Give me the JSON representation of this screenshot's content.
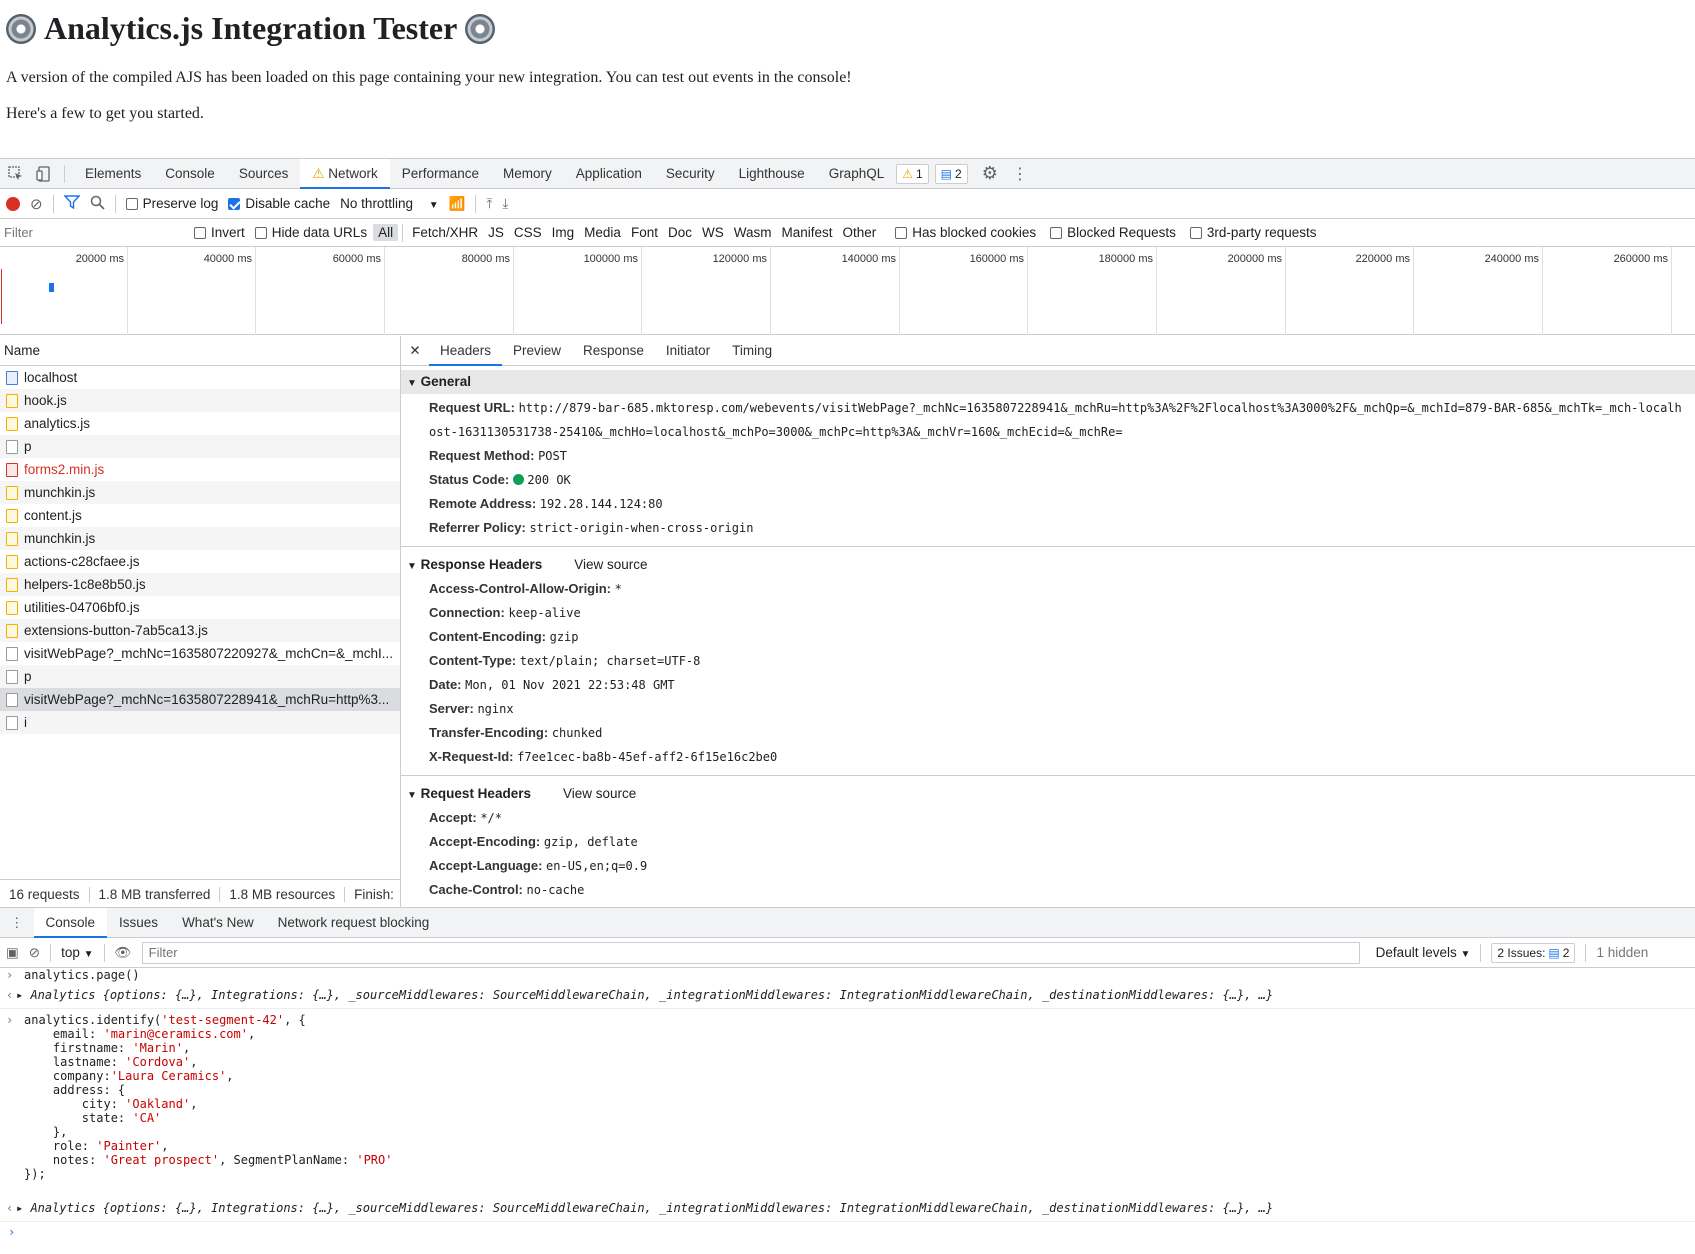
{
  "page": {
    "title": "Analytics.js Integration Tester",
    "para1": "A version of the compiled AJS has been loaded on this page containing your new integration. You can test out events in the console!",
    "para2": "Here's a few to get you started."
  },
  "devtools": {
    "tabs": [
      "Elements",
      "Console",
      "Sources",
      "Network",
      "Performance",
      "Memory",
      "Application",
      "Security",
      "Lighthouse",
      "GraphQL"
    ],
    "active_tab": "Network",
    "warn_count": "1",
    "msg_count": "2"
  },
  "network_toolbar": {
    "preserve_log": "Preserve log",
    "disable_cache": "Disable cache",
    "throttling": "No throttling"
  },
  "filterbar": {
    "placeholder": "Filter",
    "invert": "Invert",
    "hide_data_urls": "Hide data URLs",
    "types": [
      "All",
      "Fetch/XHR",
      "JS",
      "CSS",
      "Img",
      "Media",
      "Font",
      "Doc",
      "WS",
      "Wasm",
      "Manifest",
      "Other"
    ],
    "has_blocked_cookies": "Has blocked cookies",
    "blocked_requests": "Blocked Requests",
    "third_party": "3rd-party requests"
  },
  "overview": {
    "ticks": [
      "20000 ms",
      "40000 ms",
      "60000 ms",
      "80000 ms",
      "100000 ms",
      "120000 ms",
      "140000 ms",
      "160000 ms",
      "180000 ms",
      "200000 ms",
      "220000 ms",
      "240000 ms",
      "260000 ms"
    ]
  },
  "requests": {
    "header": "Name",
    "items": [
      {
        "name": "localhost",
        "kind": "doc"
      },
      {
        "name": "hook.js",
        "kind": "js"
      },
      {
        "name": "analytics.js",
        "kind": "js"
      },
      {
        "name": "p",
        "kind": "other"
      },
      {
        "name": "forms2.min.js",
        "kind": "bad"
      },
      {
        "name": "munchkin.js",
        "kind": "js"
      },
      {
        "name": "content.js",
        "kind": "js"
      },
      {
        "name": "munchkin.js",
        "kind": "js"
      },
      {
        "name": "actions-c28cfaee.js",
        "kind": "js"
      },
      {
        "name": "helpers-1c8e8b50.js",
        "kind": "js"
      },
      {
        "name": "utilities-04706bf0.js",
        "kind": "js"
      },
      {
        "name": "extensions-button-7ab5ca13.js",
        "kind": "js"
      },
      {
        "name": "visitWebPage?_mchNc=1635807220927&_mchCn=&_mchI...",
        "kind": "other"
      },
      {
        "name": "p",
        "kind": "other"
      },
      {
        "name": "visitWebPage?_mchNc=1635807228941&_mchRu=http%3...",
        "kind": "other"
      },
      {
        "name": "i",
        "kind": "other"
      }
    ],
    "footer": {
      "count": "16 requests",
      "transferred": "1.8 MB transferred",
      "resources": "1.8 MB resources",
      "finish": "Finish:"
    }
  },
  "details": {
    "tabs": [
      "Headers",
      "Preview",
      "Response",
      "Initiator",
      "Timing"
    ],
    "general_title": "General",
    "general": {
      "url_label": "Request URL:",
      "url_1": "http://879-bar-685.mktoresp.com/webevents/visitWebPage?_mchNc=1635807228941&_mchRu=http%3A%2F%2Flocalhost%3A3000%2F&_mchQp=&_mchId=879-BAR-685&_mchTk=_mch-localh",
      "url_2": "ost-1631130531738-25410&_mchHo=localhost&_mchPo=3000&_mchPc=http%3A&_mchVr=160&_mchEcid=&_mchRe=",
      "method_label": "Request Method:",
      "method": "POST",
      "status_label": "Status Code:",
      "status": "200 OK",
      "remote_label": "Remote Address:",
      "remote": "192.28.144.124:80",
      "referrer_label": "Referrer Policy:",
      "referrer": "strict-origin-when-cross-origin"
    },
    "response_title": "Response Headers",
    "view_source": "View source",
    "response": [
      {
        "k": "Access-Control-Allow-Origin:",
        "v": "*"
      },
      {
        "k": "Connection:",
        "v": "keep-alive"
      },
      {
        "k": "Content-Encoding:",
        "v": "gzip"
      },
      {
        "k": "Content-Type:",
        "v": "text/plain; charset=UTF-8"
      },
      {
        "k": "Date:",
        "v": "Mon, 01 Nov 2021 22:53:48 GMT"
      },
      {
        "k": "Server:",
        "v": "nginx"
      },
      {
        "k": "Transfer-Encoding:",
        "v": "chunked"
      },
      {
        "k": "X-Request-Id:",
        "v": "f7ee1cec-ba8b-45ef-aff2-6f15e16c2be0"
      }
    ],
    "request_title": "Request Headers",
    "request": [
      {
        "k": "Accept:",
        "v": "*/*"
      },
      {
        "k": "Accept-Encoding:",
        "v": "gzip, deflate"
      },
      {
        "k": "Accept-Language:",
        "v": "en-US,en;q=0.9"
      },
      {
        "k": "Cache-Control:",
        "v": "no-cache"
      }
    ]
  },
  "drawer": {
    "tabs": [
      "Console",
      "Issues",
      "What's New",
      "Network request blocking"
    ],
    "context": "top",
    "filter_placeholder": "Filter",
    "levels": "Default levels",
    "issues_label": "2 Issues:",
    "issues_count": "2",
    "hidden": "1 hidden"
  },
  "console": {
    "cmd1": "analytics.page()",
    "result1": "Analytics {options: {…}, Integrations: {…}, _sourceMiddlewares: SourceMiddlewareChain, _integrationMiddlewares: IntegrationMiddlewareChain, _destinationMiddlewares: {…}, …}",
    "id_call": "analytics.identify(",
    "id_arg": "'test-segment-42'",
    "id_tail": ", {",
    "email_key": "    email: ",
    "email_val": "'marin@ceramics.com'",
    "first_key": "    firstname: ",
    "first_val": "'Marin'",
    "last_key": "    lastname: ",
    "last_val": "'Cordova'",
    "company_key": "    company:",
    "company_val": "'Laura Ceramics'",
    "address_open": "    address: {",
    "city_key": "        city: ",
    "city_val": "'Oakland'",
    "state_key": "        state: ",
    "state_val": "'CA'",
    "address_close": "    },",
    "role_key": "    role: ",
    "role_val": "'Painter'",
    "notes_key": "    notes: ",
    "notes_val": "'Great prospect'",
    "plan_key": ", SegmentPlanName: ",
    "plan_val": "'PRO'",
    "close": "});",
    "result2": "Analytics {options: {…}, Integrations: {…}, _sourceMiddlewares: SourceMiddlewareChain, _integrationMiddlewares: IntegrationMiddlewareChain, _destinationMiddlewares: {…}, …}"
  }
}
